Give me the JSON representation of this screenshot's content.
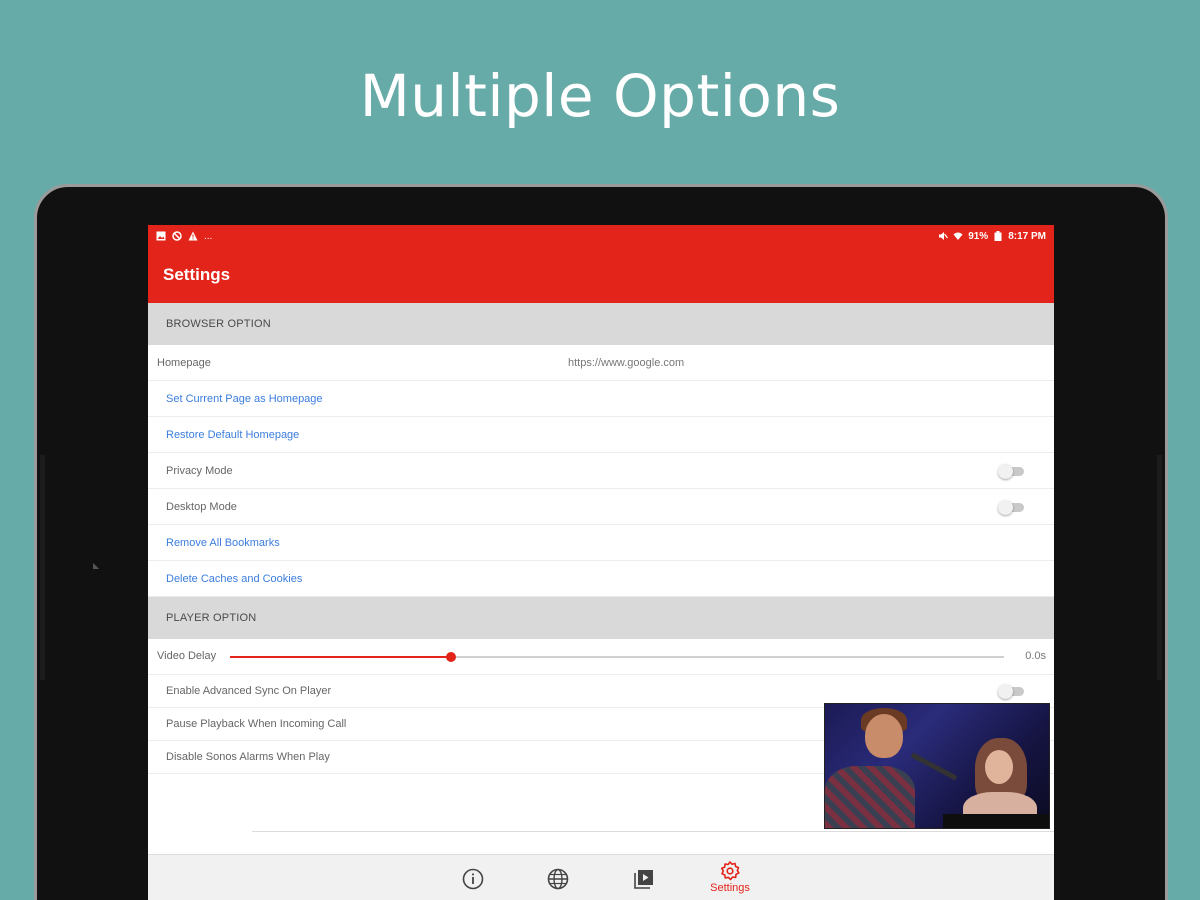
{
  "promo": {
    "headline": "Multiple Options"
  },
  "status_bar": {
    "left_icons": [
      "image-icon",
      "block-icon",
      "warning-icon"
    ],
    "overflow": "...",
    "battery": "91%",
    "time": "8:17 PM"
  },
  "app_bar": {
    "title": "Settings"
  },
  "browser_section": {
    "header": "BROWSER OPTION",
    "homepage_label": "Homepage",
    "homepage_value": "https://www.google.com",
    "set_current_label": "Set Current Page as Homepage",
    "restore_default_label": "Restore Default Homepage",
    "privacy_mode_label": "Privacy Mode",
    "privacy_mode_on": false,
    "desktop_mode_label": "Desktop Mode",
    "desktop_mode_on": false,
    "remove_bookmarks_label": "Remove All Bookmarks",
    "delete_caches_label": "Delete Caches and Cookies"
  },
  "player_section": {
    "header": "PLAYER OPTION",
    "video_delay_label": "Video Delay",
    "video_delay_value": "0.0s",
    "video_delay_fraction": 0.285,
    "advanced_sync_label": "Enable Advanced Sync On Player",
    "advanced_sync_on": false,
    "pause_playback_label": "Pause Playback When Incoming Call",
    "disable_alarms_label": "Disable Sonos Alarms When Play"
  },
  "bottom_nav": {
    "items": [
      {
        "icon": "info-icon",
        "label": ""
      },
      {
        "icon": "globe-icon",
        "label": ""
      },
      {
        "icon": "playlist-icon",
        "label": ""
      },
      {
        "icon": "settings-gear-icon",
        "label": "Settings",
        "active": true
      }
    ]
  },
  "colors": {
    "background": "#66aba7",
    "accent": "#e3241a",
    "link": "#3b7ddd"
  }
}
